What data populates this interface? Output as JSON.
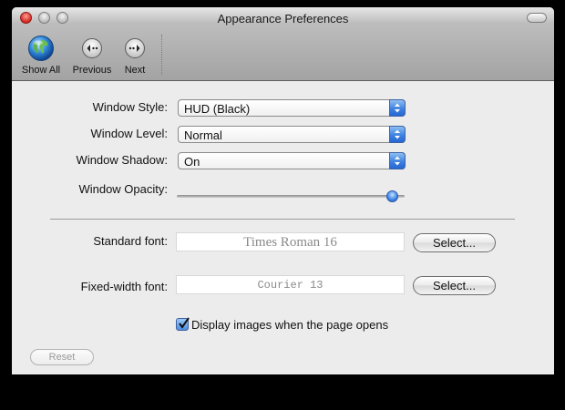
{
  "window": {
    "title": "Appearance Preferences"
  },
  "toolbar": {
    "items": [
      {
        "label": "Show All",
        "icon": "globe-icon"
      },
      {
        "label": "Previous",
        "icon": "previous-arrow-icon"
      },
      {
        "label": "Next",
        "icon": "next-arrow-icon"
      }
    ]
  },
  "settings": {
    "window_style": {
      "label": "Window Style:",
      "value": "HUD (Black)"
    },
    "window_level": {
      "label": "Window Level:",
      "value": "Normal"
    },
    "window_shadow": {
      "label": "Window Shadow:",
      "value": "On"
    },
    "window_opacity": {
      "label": "Window Opacity:",
      "value_fraction": 0.97
    }
  },
  "fonts": {
    "standard": {
      "label": "Standard font:",
      "value": "Times Roman 16",
      "button": "Select..."
    },
    "fixed": {
      "label": "Fixed-width font:",
      "value": "Courier 13",
      "button": "Select..."
    }
  },
  "display_images": {
    "label": "Display images when the page opens",
    "checked": true
  },
  "reset_label": "Reset",
  "colors": {
    "accent_blue": "#3f82e0",
    "window_bg": "#ececec",
    "close_red": "#d1271f"
  }
}
